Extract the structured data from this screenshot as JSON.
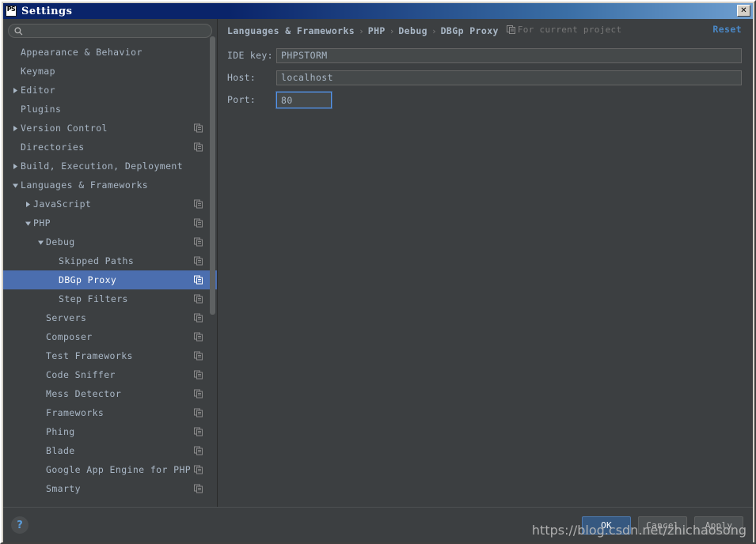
{
  "window": {
    "title": "Settings",
    "app_icon": "phpstorm-icon",
    "close_label": "✕"
  },
  "sidebar": {
    "search": {
      "placeholder": "",
      "value": "",
      "icon": "search-icon"
    },
    "items": [
      {
        "label": "Appearance & Behavior",
        "indent": 1,
        "twisty": "none",
        "scope_icon": false,
        "selected": false
      },
      {
        "label": "Keymap",
        "indent": 1,
        "twisty": "none",
        "scope_icon": false,
        "selected": false
      },
      {
        "label": "Editor",
        "indent": 1,
        "twisty": "collapsed",
        "scope_icon": false,
        "selected": false
      },
      {
        "label": "Plugins",
        "indent": 1,
        "twisty": "none",
        "scope_icon": false,
        "selected": false
      },
      {
        "label": "Version Control",
        "indent": 1,
        "twisty": "collapsed",
        "scope_icon": true,
        "selected": false
      },
      {
        "label": "Directories",
        "indent": 1,
        "twisty": "none",
        "scope_icon": true,
        "selected": false
      },
      {
        "label": "Build, Execution, Deployment",
        "indent": 1,
        "twisty": "collapsed",
        "scope_icon": false,
        "selected": false
      },
      {
        "label": "Languages & Frameworks",
        "indent": 1,
        "twisty": "expanded",
        "scope_icon": false,
        "selected": false
      },
      {
        "label": "JavaScript",
        "indent": 2,
        "twisty": "collapsed",
        "scope_icon": true,
        "selected": false
      },
      {
        "label": "PHP",
        "indent": 2,
        "twisty": "expanded",
        "scope_icon": true,
        "selected": false
      },
      {
        "label": "Debug",
        "indent": 3,
        "twisty": "expanded",
        "scope_icon": true,
        "selected": false
      },
      {
        "label": "Skipped Paths",
        "indent": 4,
        "twisty": "none",
        "scope_icon": true,
        "selected": false
      },
      {
        "label": "DBGp Proxy",
        "indent": 4,
        "twisty": "none",
        "scope_icon": true,
        "selected": true
      },
      {
        "label": "Step Filters",
        "indent": 4,
        "twisty": "none",
        "scope_icon": true,
        "selected": false
      },
      {
        "label": "Servers",
        "indent": 3,
        "twisty": "none",
        "scope_icon": true,
        "selected": false
      },
      {
        "label": "Composer",
        "indent": 3,
        "twisty": "none",
        "scope_icon": true,
        "selected": false
      },
      {
        "label": "Test Frameworks",
        "indent": 3,
        "twisty": "none",
        "scope_icon": true,
        "selected": false
      },
      {
        "label": "Code Sniffer",
        "indent": 3,
        "twisty": "none",
        "scope_icon": true,
        "selected": false
      },
      {
        "label": "Mess Detector",
        "indent": 3,
        "twisty": "none",
        "scope_icon": true,
        "selected": false
      },
      {
        "label": "Frameworks",
        "indent": 3,
        "twisty": "none",
        "scope_icon": true,
        "selected": false
      },
      {
        "label": "Phing",
        "indent": 3,
        "twisty": "none",
        "scope_icon": true,
        "selected": false
      },
      {
        "label": "Blade",
        "indent": 3,
        "twisty": "none",
        "scope_icon": true,
        "selected": false
      },
      {
        "label": "Google App Engine for PHP",
        "indent": 3,
        "twisty": "none",
        "scope_icon": true,
        "selected": false
      },
      {
        "label": "Smarty",
        "indent": 3,
        "twisty": "none",
        "scope_icon": true,
        "selected": false
      }
    ]
  },
  "panel": {
    "breadcrumb": [
      "Languages & Frameworks",
      "PHP",
      "Debug",
      "DBGp Proxy"
    ],
    "breadcrumb_separator": "›",
    "scope_note": "For current project",
    "scope_note_icon": "project-scope-icon",
    "reset_label": "Reset",
    "fields": [
      {
        "label": "IDE key:",
        "value": "PHPSTORM",
        "focused": false
      },
      {
        "label": "Host:",
        "value": "localhost",
        "focused": false
      },
      {
        "label": "Port:",
        "value": "80",
        "focused": true
      }
    ]
  },
  "footer": {
    "help_icon": "question-mark-icon",
    "help_label": "?",
    "buttons": [
      {
        "label": "OK",
        "default": true
      },
      {
        "label": "Cancel",
        "default": false
      },
      {
        "label": "Apply",
        "default": false
      }
    ],
    "watermark": "https://blog.csdn.net/zhichaosong"
  },
  "colors": {
    "accent_selection": "#4b6eaf",
    "link": "#4a88c7",
    "panel_bg": "#3c3f41",
    "input_bg": "#45494a",
    "text": "#a9b7c6",
    "default_button": "#365880",
    "focus_border": "#5394ec",
    "titlebar": "#0a246a"
  }
}
